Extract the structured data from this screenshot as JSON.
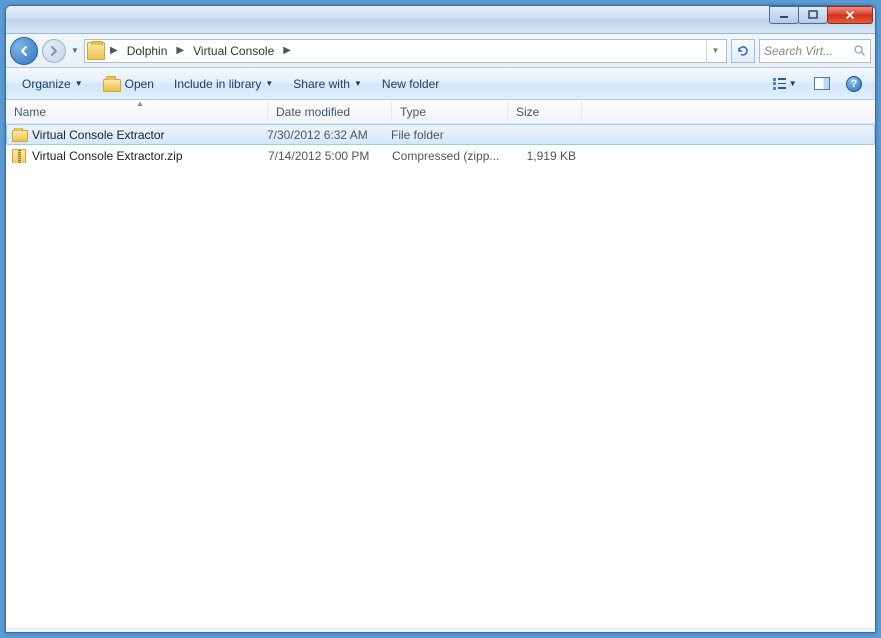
{
  "breadcrumb": {
    "seg1": "Dolphin",
    "seg2": "Virtual Console"
  },
  "search": {
    "placeholder": "Search Virt..."
  },
  "toolbar": {
    "organize": "Organize",
    "open": "Open",
    "include": "Include in library",
    "share": "Share with",
    "newfolder": "New folder"
  },
  "columns": {
    "name": "Name",
    "date": "Date modified",
    "type": "Type",
    "size": "Size"
  },
  "rows": [
    {
      "icon": "folder",
      "name": "Virtual Console Extractor",
      "date": "7/30/2012 6:32 AM",
      "type": "File folder",
      "size": "",
      "selected": true
    },
    {
      "icon": "zip",
      "name": "Virtual Console Extractor.zip",
      "date": "7/14/2012 5:00 PM",
      "type": "Compressed (zipp...",
      "size": "1,919 KB",
      "selected": false
    }
  ]
}
